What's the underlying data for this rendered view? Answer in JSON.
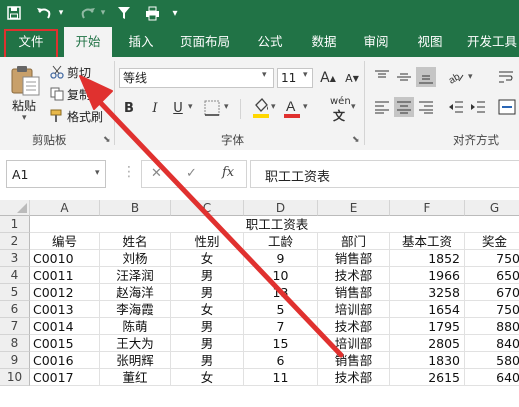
{
  "quick_access": {
    "save_icon": "save-icon",
    "undo_icon": "undo-icon",
    "redo_icon": "redo-icon",
    "filter_icon": "filter-icon",
    "print_icon": "print-icon",
    "customize_icon": "customize-icon"
  },
  "tabs": [
    {
      "label": "文件"
    },
    {
      "label": "开始",
      "active": true
    },
    {
      "label": "插入"
    },
    {
      "label": "页面布局"
    },
    {
      "label": "公式"
    },
    {
      "label": "数据"
    },
    {
      "label": "审阅"
    },
    {
      "label": "视图"
    },
    {
      "label": "开发工具"
    }
  ],
  "ribbon": {
    "clipboard": {
      "paste_label": "粘贴",
      "cut_label": "剪切",
      "copy_label": "复制",
      "format_painter_label": "格式刷",
      "group_label": "剪贴板"
    },
    "font": {
      "font_name": "等线",
      "font_size": "11",
      "grow_label": "A",
      "shrink_label": "A",
      "bold": "B",
      "italic": "I",
      "underline": "U",
      "phonetic_label": "wén",
      "group_label": "字体"
    },
    "alignment": {
      "group_label": "对齐方式"
    }
  },
  "formula_bar": {
    "name_box": "A1",
    "cancel": "✕",
    "enter": "✓",
    "fx": "fx",
    "content": "职工工资表"
  },
  "sheet": {
    "columns": [
      "A",
      "B",
      "C",
      "D",
      "E",
      "F",
      "G"
    ],
    "rows": [
      "1",
      "2",
      "3",
      "4",
      "5",
      "6",
      "7",
      "8",
      "9",
      "10"
    ],
    "title": "职工工资表",
    "headers": [
      "编号",
      "姓名",
      "性别",
      "工龄",
      "部门",
      "基本工资",
      "奖金"
    ],
    "data": [
      [
        "C0010",
        "刘杨",
        "女",
        "9",
        "销售部",
        "1852",
        "750"
      ],
      [
        "C0011",
        "汪泽润",
        "男",
        "10",
        "技术部",
        "1966",
        "650"
      ],
      [
        "C0012",
        "赵海洋",
        "男",
        "13",
        "销售部",
        "3258",
        "670"
      ],
      [
        "C0013",
        "李海霞",
        "女",
        "5",
        "培训部",
        "1654",
        "750"
      ],
      [
        "C0014",
        "陈萌",
        "男",
        "7",
        "技术部",
        "1795",
        "880"
      ],
      [
        "C0015",
        "王大为",
        "男",
        "15",
        "培训部",
        "2805",
        "840"
      ],
      [
        "C0016",
        "张明辉",
        "男",
        "6",
        "销售部",
        "1830",
        "580"
      ],
      [
        "C0017",
        "董红",
        "女",
        "11",
        "技术部",
        "2615",
        "640"
      ]
    ]
  },
  "annotation": {
    "color": "#e0312f"
  }
}
